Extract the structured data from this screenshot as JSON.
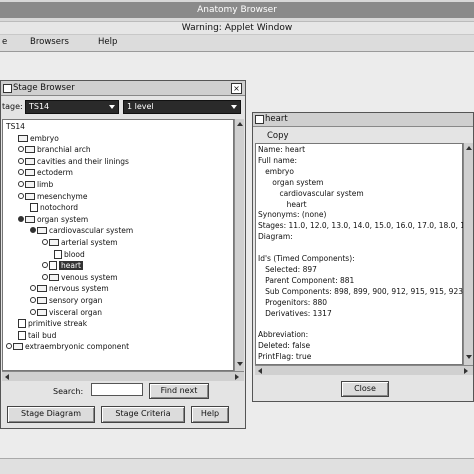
{
  "app": {
    "title": "Anatomy Browser",
    "warning": "Warning: Applet Window",
    "menus": [
      "e",
      "Browsers",
      "Help"
    ]
  },
  "stage_browser": {
    "title": "Stage Browser",
    "stage_label": "tage:",
    "stage_value": "TS14",
    "level_value": "1 level",
    "tree": [
      {
        "label": "TS14",
        "indent": 0,
        "icon": "none",
        "knob": "none"
      },
      {
        "label": "embryo",
        "indent": 1,
        "icon": "folder",
        "knob": "none"
      },
      {
        "label": "branchial arch",
        "indent": 1,
        "icon": "folder",
        "knob": "closed"
      },
      {
        "label": "cavities and their linings",
        "indent": 1,
        "icon": "folder",
        "knob": "closed"
      },
      {
        "label": "ectoderm",
        "indent": 1,
        "icon": "folder",
        "knob": "closed"
      },
      {
        "label": "limb",
        "indent": 1,
        "icon": "folder",
        "knob": "closed"
      },
      {
        "label": "mesenchyme",
        "indent": 1,
        "icon": "folder",
        "knob": "closed"
      },
      {
        "label": "notochord",
        "indent": 2,
        "icon": "doc",
        "knob": "none"
      },
      {
        "label": "organ system",
        "indent": 1,
        "icon": "folder",
        "knob": "open"
      },
      {
        "label": "cardiovascular system",
        "indent": 2,
        "icon": "folder",
        "knob": "open"
      },
      {
        "label": "arterial system",
        "indent": 3,
        "icon": "folder",
        "knob": "closed"
      },
      {
        "label": "blood",
        "indent": 4,
        "icon": "doc",
        "knob": "none"
      },
      {
        "label": "heart",
        "indent": 3,
        "icon": "doc",
        "knob": "closed",
        "selected": true
      },
      {
        "label": "venous system",
        "indent": 3,
        "icon": "folder",
        "knob": "closed"
      },
      {
        "label": "nervous system",
        "indent": 2,
        "icon": "folder",
        "knob": "closed"
      },
      {
        "label": "sensory organ",
        "indent": 2,
        "icon": "folder",
        "knob": "closed"
      },
      {
        "label": "visceral organ",
        "indent": 2,
        "icon": "folder",
        "knob": "closed"
      },
      {
        "label": "primitive streak",
        "indent": 1,
        "icon": "doc",
        "knob": "none"
      },
      {
        "label": "tail bud",
        "indent": 1,
        "icon": "doc",
        "knob": "none"
      },
      {
        "label": "extraembryonic component",
        "indent": 0,
        "icon": "folder",
        "knob": "closed"
      }
    ],
    "search_label": "Search:",
    "search_value": "",
    "find_next_label": "Find next",
    "stage_diagram_label": "Stage Diagram",
    "stage_criteria_label": "Stage Criteria",
    "help_label": "Help"
  },
  "heart_window": {
    "title": "heart",
    "copy_label": "Copy",
    "lines": [
      "Name: heart",
      "Full name:",
      "   embryo",
      "      organ system",
      "         cardiovascular system",
      "            heart",
      "Synonyms: (none)",
      "Stages: 11.0, 12.0, 13.0, 14.0, 15.0, 16.0, 17.0, 18.0, 1",
      "Diagram:",
      "",
      "Id's (Timed Components):",
      "   Selected: 897",
      "   Parent Component: 881",
      "   Sub Components: 898, 899, 900, 912, 915, 915, 923",
      "   Progenitors: 880",
      "   Derivatives: 1317",
      "",
      "Abbreviation:",
      "Deleted: false",
      "PrintFlag: true"
    ],
    "close_label": "Close"
  }
}
